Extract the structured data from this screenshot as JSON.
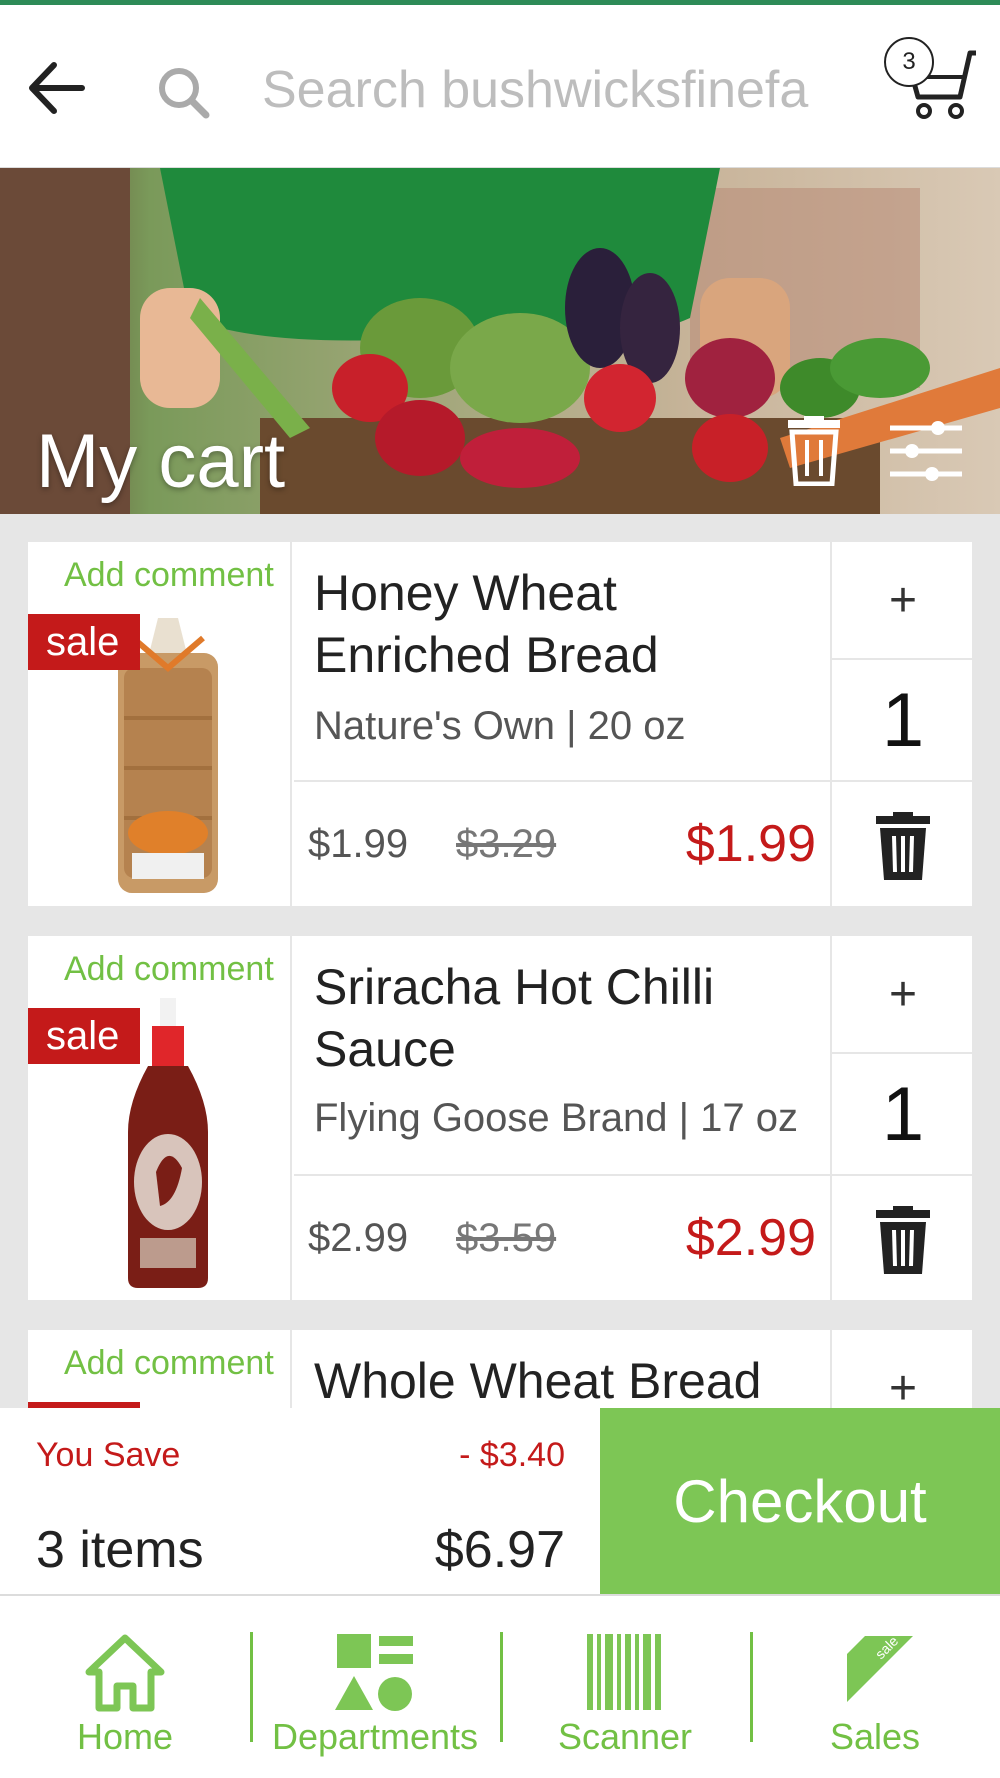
{
  "header": {
    "search_placeholder": "Search bushwicksfinefa",
    "cart_count": "3"
  },
  "hero": {
    "title": "My cart"
  },
  "items": [
    {
      "add_comment": "Add comment",
      "badge": "sale",
      "name": "Honey Wheat Enriched Bread",
      "subtitle": "Nature's Own | 20 oz",
      "price": "$1.99",
      "original_price": "$3.29",
      "final_price": "$1.99",
      "plus": "+",
      "quantity": "1"
    },
    {
      "add_comment": "Add comment",
      "badge": "sale",
      "name": "Sriracha Hot Chilli Sauce",
      "subtitle": "Flying Goose Brand | 17 oz",
      "price": "$2.99",
      "original_price": "$3.59",
      "final_price": "$2.99",
      "plus": "+",
      "quantity": "1"
    },
    {
      "add_comment": "Add comment",
      "name": "Whole Wheat Bread",
      "plus": "+"
    }
  ],
  "summary": {
    "you_save_label": "You Save",
    "you_save_amount": "- $3.40",
    "item_count": "3 items",
    "total": "$6.97",
    "checkout_label": "Checkout"
  },
  "nav": [
    {
      "label": "Home",
      "icon": "home-icon"
    },
    {
      "label": "Departments",
      "icon": "departments-icon"
    },
    {
      "label": "Scanner",
      "icon": "barcode-icon"
    },
    {
      "label": "Sales",
      "icon": "sale-tag-icon"
    }
  ],
  "colors": {
    "accent_green": "#7dc655",
    "sale_red": "#c41a1a",
    "top_bar": "#2e8b57"
  }
}
